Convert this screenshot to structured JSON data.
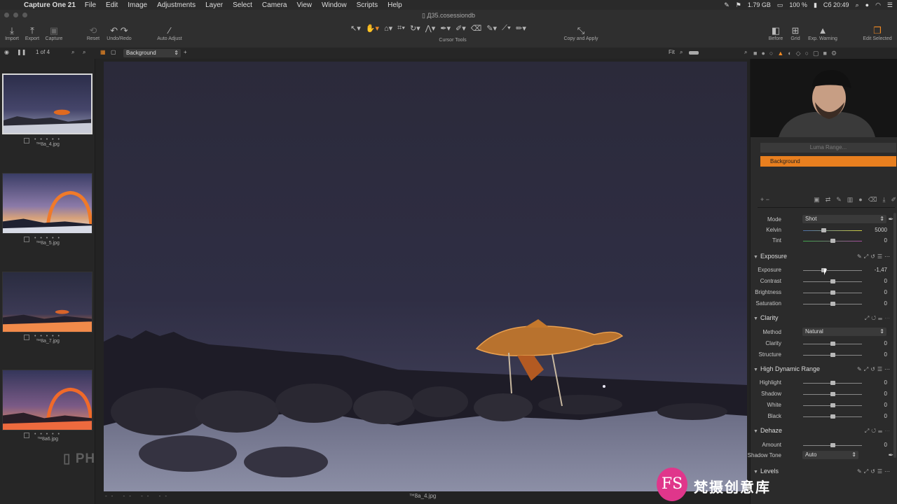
{
  "menubar": {
    "app": "Capture One 21",
    "items": [
      "File",
      "Edit",
      "Image",
      "Adjustments",
      "Layer",
      "Select",
      "Camera",
      "View",
      "Window",
      "Scripts",
      "Help"
    ],
    "status": {
      "memory": "1.79 GB",
      "battery": "100 %",
      "clock": "Сб 20:49"
    }
  },
  "window": {
    "title": "Д35.cosessiondb"
  },
  "toolbar": {
    "left": [
      {
        "label": "Import",
        "icon": "import-icon"
      },
      {
        "label": "Export",
        "icon": "export-icon"
      },
      {
        "label": "Capture",
        "icon": "camera-icon"
      },
      {
        "label": "Reset",
        "icon": "reset-icon"
      },
      {
        "label": "Undo/Redo",
        "icon": "undo-icon"
      },
      {
        "label": "Auto Adjust",
        "icon": "wand-icon"
      }
    ],
    "center_label": "Cursor Tools",
    "copy_apply": "Copy and Apply",
    "right": [
      {
        "label": "Before",
        "icon": "before-icon"
      },
      {
        "label": "Grid",
        "icon": "grid-icon"
      },
      {
        "label": "Exp. Warning",
        "icon": "warning-icon"
      },
      {
        "label": "Edit Selected",
        "icon": "edit-selected-icon"
      }
    ]
  },
  "subbar": {
    "counter": "1 of 4",
    "layer": "Background",
    "fit": "Fit"
  },
  "browser": {
    "items": [
      {
        "name": "™8a_4.jpg",
        "selected": true
      },
      {
        "name": "™8a_5.jpg",
        "selected": false
      },
      {
        "name": "™8a_7.jpg",
        "selected": false
      },
      {
        "name": "™8a6.jpg",
        "selected": false
      }
    ],
    "stars": "• • • • •",
    "watermark": "PHOTO"
  },
  "viewer": {
    "caption": "™8a_4.jpg",
    "dashes": "-- -- -- --"
  },
  "layers": {
    "luma": "Luma Range...",
    "background": "Background"
  },
  "white_balance": {
    "mode_label": "Mode",
    "mode_value": "Shot",
    "kelvin_label": "Kelvin",
    "kelvin_value": "5000",
    "kelvin_pos": 0.35,
    "tint_label": "Tint",
    "tint_value": "0",
    "tint_pos": 0.5
  },
  "exposure": {
    "title": "Exposure",
    "rows": [
      {
        "label": "Exposure",
        "value": "-1,47",
        "pos": 0.35
      },
      {
        "label": "Contrast",
        "value": "0",
        "pos": 0.5
      },
      {
        "label": "Brightness",
        "value": "0",
        "pos": 0.5
      },
      {
        "label": "Saturation",
        "value": "0",
        "pos": 0.5
      }
    ]
  },
  "clarity": {
    "title": "Clarity",
    "method_label": "Method",
    "method_value": "Natural",
    "rows": [
      {
        "label": "Clarity",
        "value": "0",
        "pos": 0.5
      },
      {
        "label": "Structure",
        "value": "0",
        "pos": 0.5
      }
    ]
  },
  "hdr": {
    "title": "High Dynamic Range",
    "rows": [
      {
        "label": "Highlight",
        "value": "0",
        "pos": 0.5
      },
      {
        "label": "Shadow",
        "value": "0",
        "pos": 0.5
      },
      {
        "label": "White",
        "value": "0",
        "pos": 0.5
      },
      {
        "label": "Black",
        "value": "0",
        "pos": 0.5
      }
    ]
  },
  "dehaze": {
    "title": "Dehaze",
    "amount_label": "Amount",
    "amount_value": "0",
    "amount_pos": 0.5,
    "shadow_label": "Shadow Tone",
    "shadow_value": "Auto"
  },
  "levels": {
    "title": "Levels"
  },
  "overlay": {
    "badge": "FS",
    "text": "梵摄创意库"
  },
  "colors": {
    "accent": "#f08a24",
    "layer_selected": "#e87f1f",
    "badge": "#e0368b"
  }
}
